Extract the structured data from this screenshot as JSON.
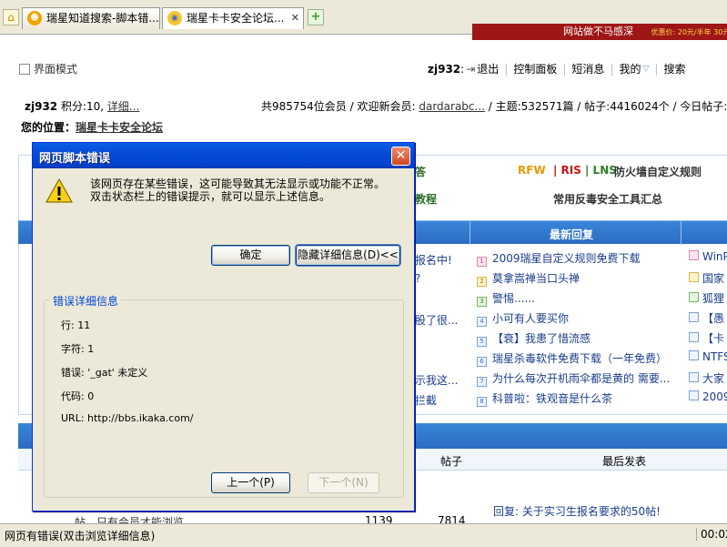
{
  "browser": {
    "tabs": [
      {
        "title": "瑞星知道搜索-脚本错..."
      },
      {
        "title": "瑞星卡卡安全论坛...",
        "close": "✕"
      }
    ],
    "new_tab_symbol": "+"
  },
  "banner": {
    "text": "网站做不马感深",
    "small": "优惠价: 20元/半年 30元"
  },
  "toolbar": {
    "mode_label": "界面模式",
    "username": "zj932",
    "colon": ":",
    "logout": "退出",
    "control_panel": "控制面板",
    "messages": "短消息",
    "mine": "我的",
    "search": "搜索"
  },
  "infobar": {
    "user": "zj932",
    "points": " 积分:10, ",
    "detail_link": "详细...",
    "members_text": "共985754位会员 / 欢迎新会员: ",
    "new_member": "dardarabc...",
    "stats": " / 主题:532571篇 / 帖子:4416024个 / 今日帖子:20"
  },
  "position": {
    "label": "您的位置：",
    "link": "瑞星卡卡安全论坛"
  },
  "content": {
    "row1": {
      "a": "答",
      "b": "RFW",
      "c": "| RIS",
      "d": "| LNS",
      "e": "防火墙自定义规则"
    },
    "row2": {
      "a": "教程",
      "b": "常用反毒安全工具汇总"
    },
    "latest_reply_header": "最新回复",
    "mid_texts": [
      "报名中!",
      "?",
      "股了很...",
      "示我这...",
      "拦截"
    ],
    "replies": [
      "2009瑞星自定义规则免费下载",
      "莫拿嵩禅当口头禅",
      "警惕......",
      "小可有人要买你",
      "【衰】我患了惜流感",
      "瑞星杀毒软件免费下载（一年免费）",
      "为什么每次开机雨伞都是黄的 需要...",
      "科普啦：铁观音是什么茶"
    ],
    "far_replies": [
      "WinP",
      "国家",
      "狐狸",
      "【愚",
      "【卡",
      "NTFS",
      "大家",
      "2009"
    ],
    "bottom": {
      "col_posts": "帖子",
      "col_last": "最后发表",
      "last_post": "回复: 关于实习生报名要求的50帖!",
      "num1": "1139",
      "num2": "7814",
      "partial_text": "帖，只有会员才能浏览。"
    }
  },
  "dialog": {
    "title": "网页脚本错误",
    "close": "✕",
    "message_line1": "该网页存在某些错误，这可能导致其无法显示或功能不正常。",
    "message_line2": "双击状态栏上的错误提示，就可以显示上述信息。",
    "ok_button": "确定",
    "hide_details_button": "隐藏详细信息(D)<<",
    "details_title": "错误详细信息",
    "details": [
      "行: 11",
      "字符: 1",
      "错误: '_gat' 未定义",
      "代码: 0",
      "URL: http://bbs.ikaka.com/"
    ],
    "prev_button": "上一个(P)",
    "next_button": "下一个(N)"
  },
  "statusbar": {
    "message": "网页有错误(双击浏览详细信息)",
    "time": "00:02"
  }
}
